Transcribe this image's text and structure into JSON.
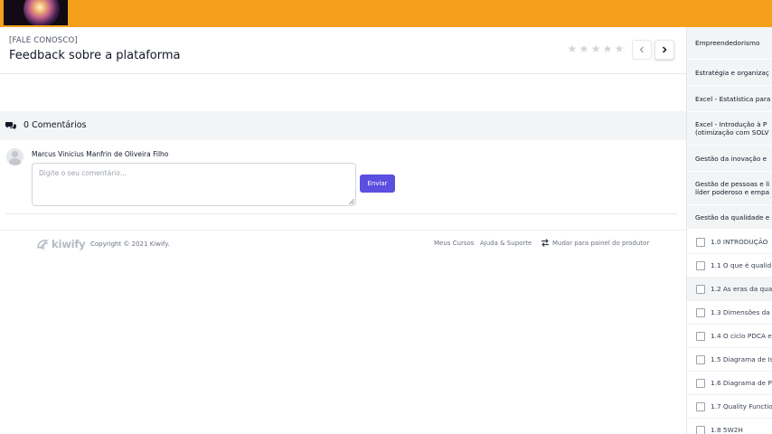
{
  "header": {
    "brand_color": "#f5a01c"
  },
  "content": {
    "kicker": "[FALE CONOSCO]",
    "title": "Feedback sobre a plataforma",
    "rating": {
      "max": 5,
      "value": 0
    }
  },
  "comments": {
    "count_label": "0 Comentários",
    "user_name": "Marcus Vinicius Manfrin de Oliveira Filho",
    "placeholder": "Digite o seu comentário...",
    "send_label": "Enviar",
    "send_color": "#5b4fe0"
  },
  "footer": {
    "logo_text": "kiwify",
    "copyright": "Copyright © 2021 Kiwify.",
    "links": [
      "Meus Cursos",
      "Ajuda & Suporte",
      "Mudar para painel do produtor"
    ]
  },
  "sidebar": {
    "modules": [
      {
        "label": "Empreendedorismo"
      },
      {
        "label": "Estratégia e organizaç"
      },
      {
        "label": "Excel - Estatística para"
      },
      {
        "label": "Excel - Introdução à P\n(otimização com SOLV"
      },
      {
        "label": "Gestão da inovação e"
      },
      {
        "label": "Gestão de pessoas e li\nlíder poderoso e empa"
      },
      {
        "label": "Gestão da qualidade e"
      }
    ],
    "lessons": [
      {
        "label": "1.0 INTRODUÇÃO"
      },
      {
        "label": "1.1 O que é qualid"
      },
      {
        "label": "1.2 As eras da qua"
      },
      {
        "label": "1.3 Dimensões da"
      },
      {
        "label": "1.4 O ciclo PDCA e"
      },
      {
        "label": "1.5 Diagrama de Is"
      },
      {
        "label": "1.6 Diagrama de P"
      },
      {
        "label": "1.7 Quality Functio"
      },
      {
        "label": "1.8 5W2H"
      }
    ]
  }
}
